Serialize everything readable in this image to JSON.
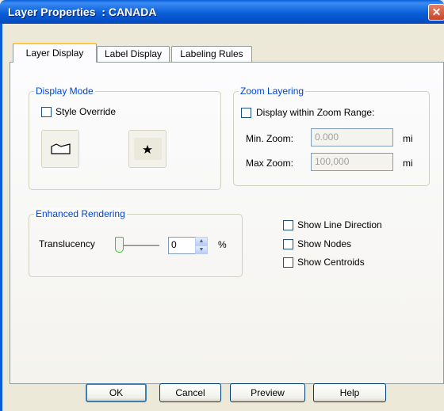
{
  "window": {
    "title": "Layer Properties  : CANADA",
    "close_glyph": "✕"
  },
  "tabs": [
    {
      "label": "Layer Display",
      "active": true
    },
    {
      "label": "Label Display",
      "active": false
    },
    {
      "label": "Labeling Rules",
      "active": false
    }
  ],
  "display_mode": {
    "title": "Display Mode",
    "style_override_label": "Style Override",
    "style_override_checked": false,
    "area_symbol_icon": "area-symbol-icon",
    "point_symbol_icon": "star-symbol-icon"
  },
  "zoom_layering": {
    "title": "Zoom Layering",
    "display_within_label": "Display within Zoom Range:",
    "display_within_checked": false,
    "min_zoom_label": "Min. Zoom:",
    "min_zoom_value": "0.000",
    "max_zoom_label": "Max Zoom:",
    "max_zoom_value": "100,000",
    "unit": "mi"
  },
  "enhanced_rendering": {
    "title": "Enhanced Rendering",
    "translucency_label": "Translucency",
    "translucency_value": "0",
    "translucency_unit": "%",
    "translucency_level_percent": 0
  },
  "options": [
    {
      "label": "Show Line Direction",
      "checked": false
    },
    {
      "label": "Show Nodes",
      "checked": false
    },
    {
      "label": "Show Centroids",
      "checked": false
    }
  ],
  "buttons": {
    "ok": "OK",
    "cancel": "Cancel",
    "preview": "Preview",
    "help": "Help"
  },
  "colors": {
    "accent": "#0a5fd8",
    "group_title": "#0046d5",
    "tab_highlight": "#ffc83c"
  }
}
